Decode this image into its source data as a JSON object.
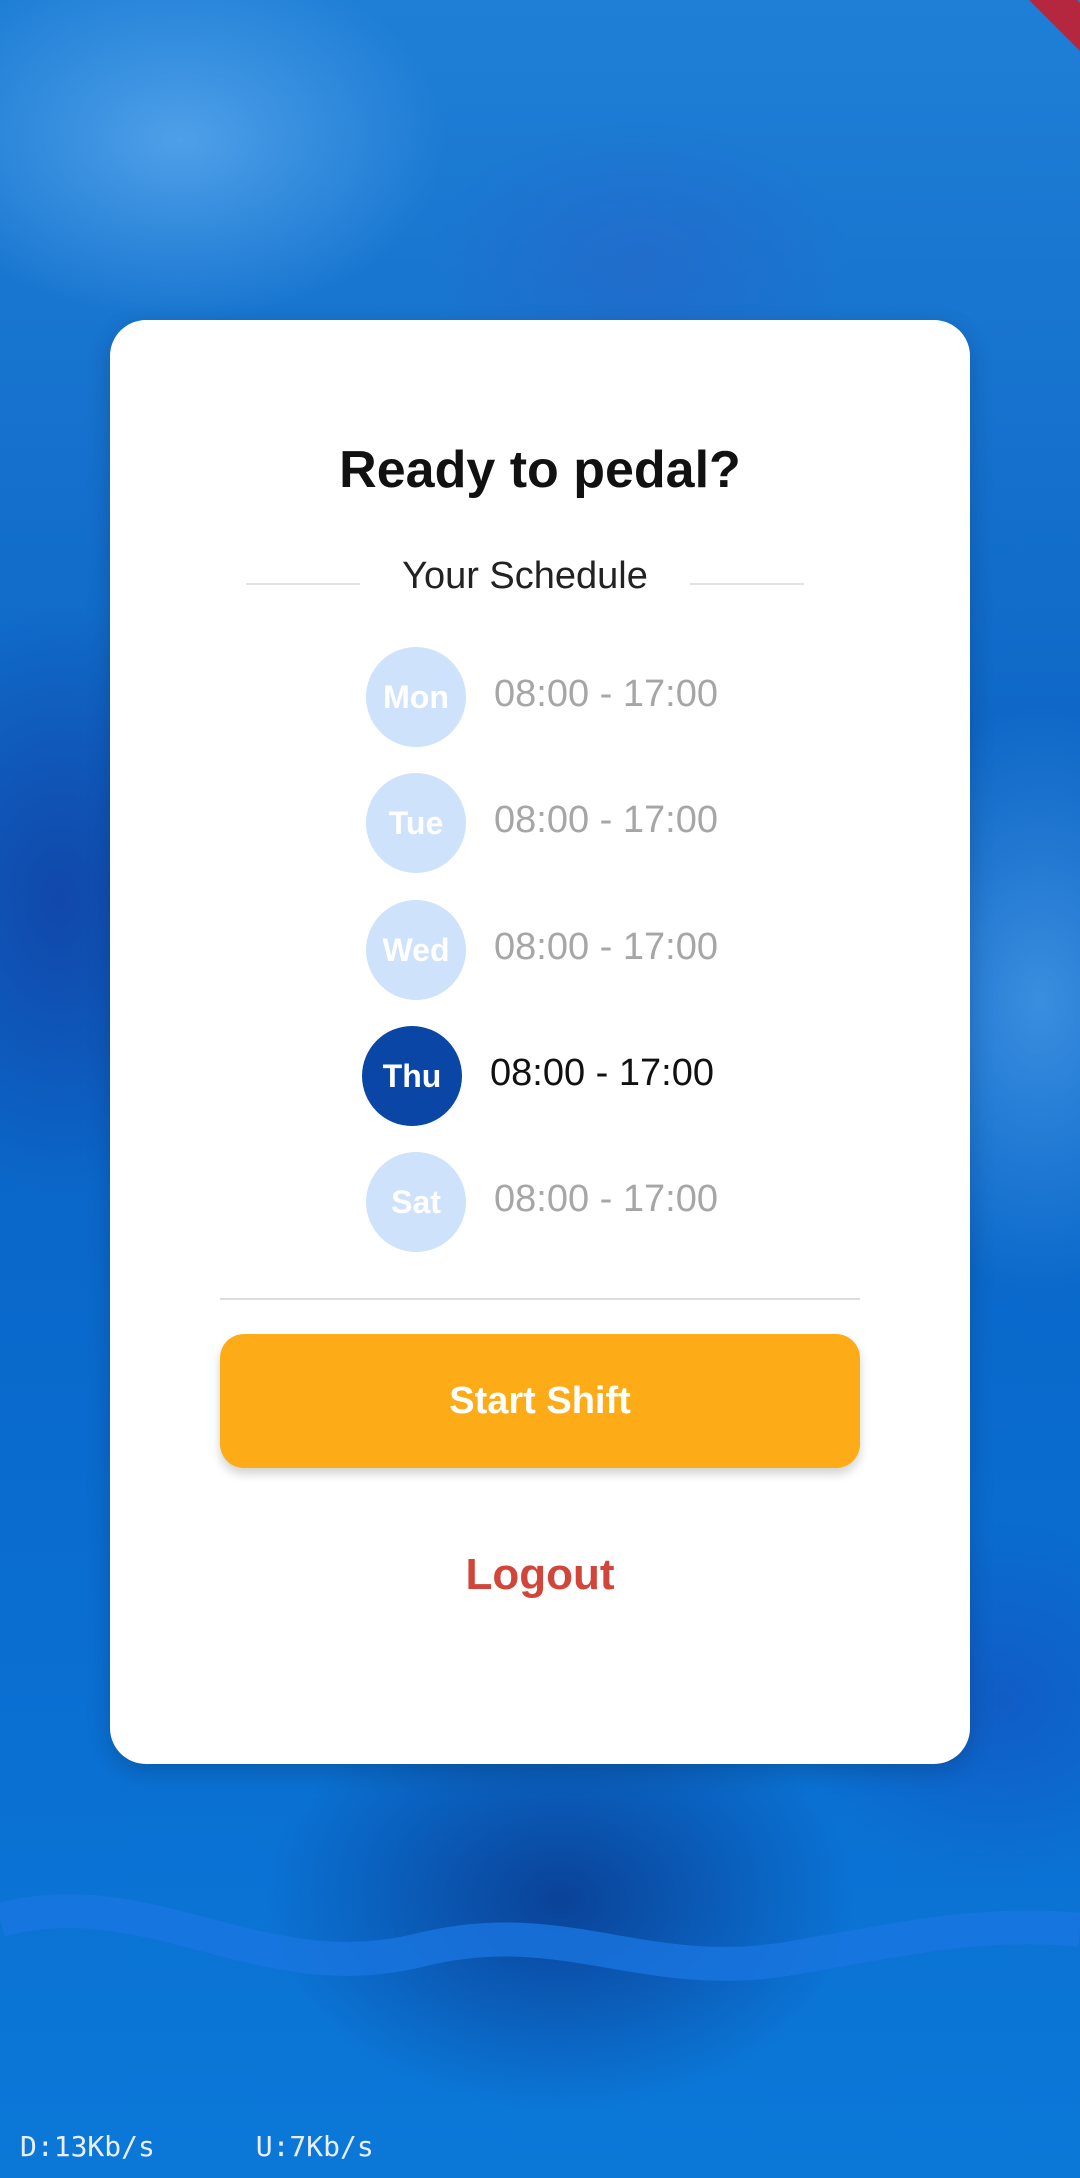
{
  "card": {
    "title": "Ready to pedal?",
    "schedule_label": "Your Schedule"
  },
  "schedule": [
    {
      "day": "Mon",
      "hours": "08:00 - 17:00",
      "active": false
    },
    {
      "day": "Tue",
      "hours": "08:00 - 17:00",
      "active": false
    },
    {
      "day": "Wed",
      "hours": "08:00 - 17:00",
      "active": false
    },
    {
      "day": "Thu",
      "hours": "08:00 - 17:00",
      "active": true
    },
    {
      "day": "Sat",
      "hours": "08:00 - 17:00",
      "active": false
    }
  ],
  "actions": {
    "start_label": "Start Shift",
    "logout_label": "Logout"
  },
  "status_overlay": {
    "download": "D:13Kb/s",
    "upload": "U:7Kb/s"
  },
  "colors": {
    "accent_button": "#fdab17",
    "active_day": "#0a46a6",
    "inactive_day": "#cfe2fb",
    "logout": "#d2453a"
  }
}
